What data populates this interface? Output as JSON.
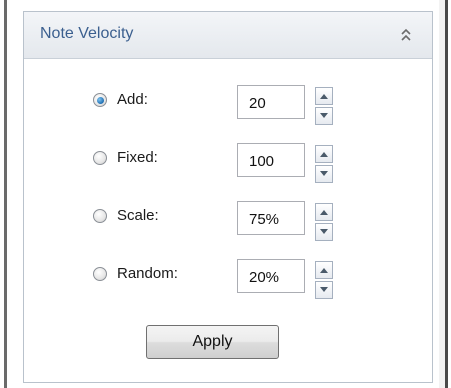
{
  "panel": {
    "title": "Note Velocity",
    "collapse_icon": "double-chevron-up-icon"
  },
  "options": [
    {
      "label": "Add:",
      "value": "20",
      "checked": true
    },
    {
      "label": "Fixed:",
      "value": "100",
      "checked": false
    },
    {
      "label": "Scale:",
      "value": "75%",
      "checked": false
    },
    {
      "label": "Random:",
      "value": "20%",
      "checked": false
    }
  ],
  "spinner_icons": {
    "up": "arrow-up-icon",
    "down": "arrow-down-icon"
  },
  "apply_label": "Apply",
  "colors": {
    "title": "#3b5f8f",
    "radio_selected": "#1f6fb3"
  }
}
